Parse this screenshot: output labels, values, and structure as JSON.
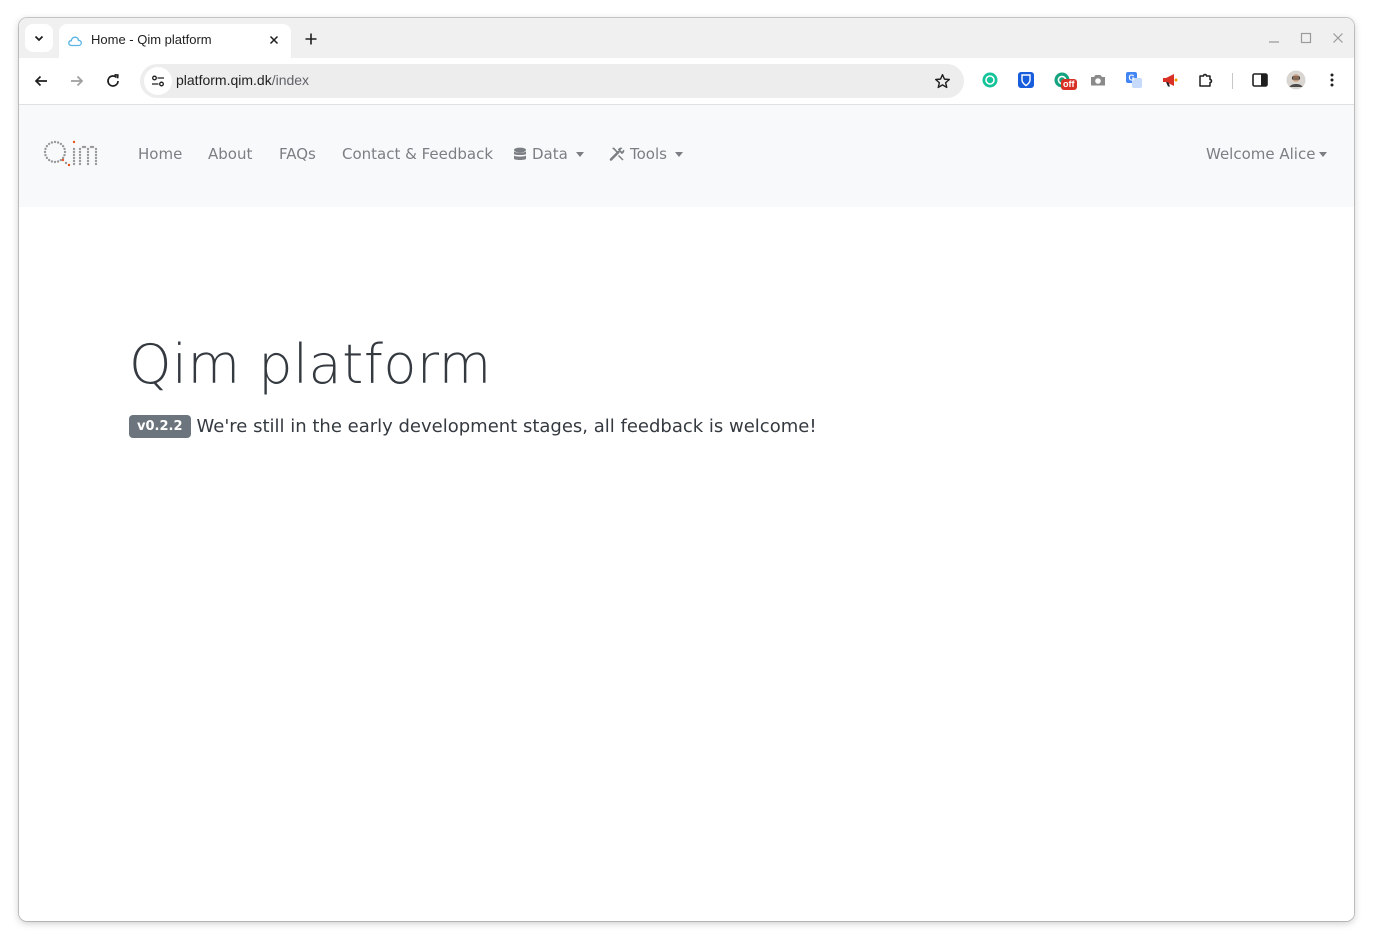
{
  "browser": {
    "tab": {
      "title": "Home - Qim platform",
      "favicon": "cloud-icon"
    },
    "omnibox": {
      "host": "platform.qim.dk",
      "path": "/index"
    },
    "extension_badge": "off"
  },
  "navbar": {
    "brand": "Qim",
    "links": {
      "home": "Home",
      "about": "About",
      "faqs": "FAQs",
      "contact": "Contact & Feedback",
      "data": "Data",
      "tools": "Tools"
    },
    "user_menu": "Welcome Alice"
  },
  "hero": {
    "title": "Qim platform",
    "version": "v0.2.2",
    "lead": "We're still in the early development stages, all feedback is welcome!"
  },
  "colors": {
    "navbar_bg": "#f8f9fa",
    "nav_link": "#7b7f84",
    "badge_bg": "#6c757d",
    "text": "#343a40",
    "logo_accent": "#e8541e"
  }
}
